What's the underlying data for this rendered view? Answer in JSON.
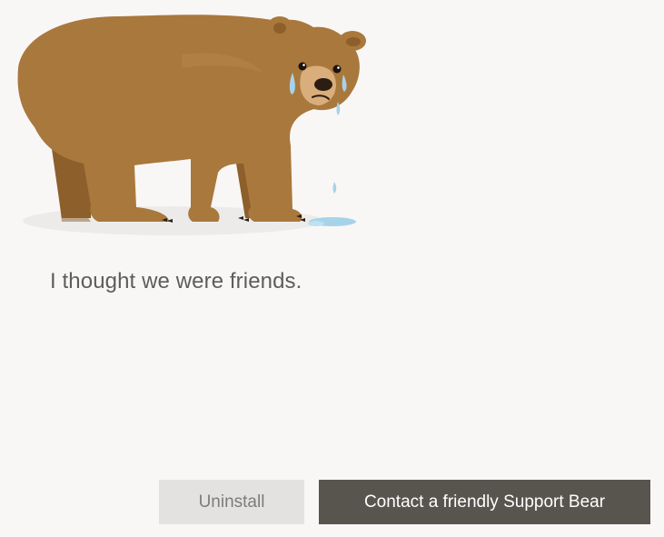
{
  "message": "I thought we were friends.",
  "buttons": {
    "uninstall_label": "Uninstall",
    "contact_label": "Contact a friendly Support Bear"
  },
  "illustration": {
    "subject": "crying-bear-illustration",
    "colors": {
      "fur": "#a9783c",
      "fur_shadow": "#8c5f2b",
      "muzzle": "#d9ad7c",
      "nose": "#2b1d12",
      "tears": "#a6d3ea",
      "ground_shadow": "#ecebea"
    }
  },
  "colors": {
    "background": "#f9f7f6",
    "message_text": "#5d5d5b",
    "secondary_button_bg": "#e3e2e1",
    "secondary_button_text": "#7e7c7a",
    "primary_button_bg": "#58554f",
    "primary_button_text": "#ffffff"
  }
}
